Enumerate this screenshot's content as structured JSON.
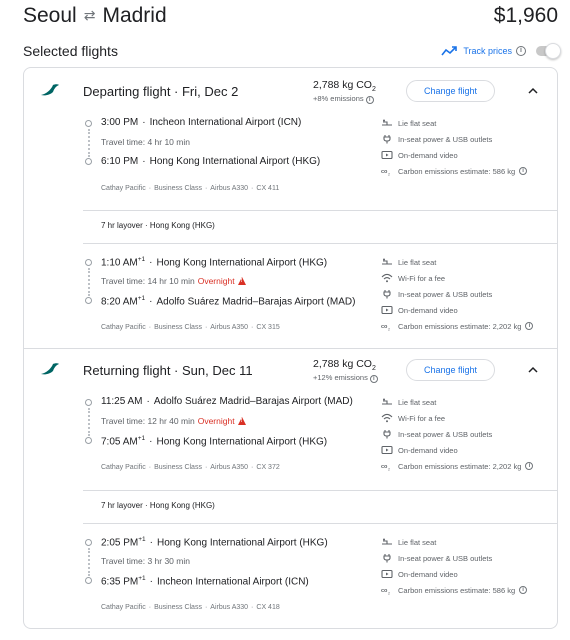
{
  "header": {
    "origin": "Seoul",
    "destination": "Madrid",
    "price": "$1,960"
  },
  "selected": {
    "title": "Selected flights",
    "track_label": "Track prices",
    "track_enabled": false
  },
  "colors": {
    "accent": "#1a73e8",
    "warning": "#d93025",
    "airline": "#006564"
  },
  "departing": {
    "title": "Departing flight · Fri, Dec 2",
    "co2": "2,788 kg CO",
    "co2_sub": "2",
    "emissions": "+8% emissions",
    "change_label": "Change flight",
    "legs": [
      {
        "dep_time": "3:00 PM",
        "dep_sup": "",
        "dep_airport": "Incheon International Airport (ICN)",
        "travel": "Travel time: 4 hr 10 min",
        "overnight": "",
        "arr_time": "6:10 PM",
        "arr_sup": "",
        "arr_airport": "Hong Kong International Airport (HKG)",
        "meta": [
          "Cathay Pacific",
          "Business Class",
          "Airbus A330",
          "CX 411"
        ],
        "amenities": [
          {
            "icon": "lie-flat-seat-icon",
            "label": "Lie flat seat"
          },
          {
            "icon": "power-outlet-icon",
            "label": "In-seat power & USB outlets"
          },
          {
            "icon": "video-icon",
            "label": "On-demand video"
          },
          {
            "icon": "co2-icon",
            "label": "Carbon emissions estimate: 586 kg"
          }
        ]
      },
      {
        "dep_time": "1:10 AM",
        "dep_sup": "+1",
        "dep_airport": "Hong Kong International Airport (HKG)",
        "travel": "Travel time: 14 hr 10 min",
        "overnight": "Overnight",
        "arr_time": "8:20 AM",
        "arr_sup": "+1",
        "arr_airport": "Adolfo Suárez Madrid–Barajas Airport (MAD)",
        "meta": [
          "Cathay Pacific",
          "Business Class",
          "Airbus A350",
          "CX 315"
        ],
        "amenities": [
          {
            "icon": "lie-flat-seat-icon",
            "label": "Lie flat seat"
          },
          {
            "icon": "wifi-icon",
            "label": "Wi-Fi for a fee"
          },
          {
            "icon": "power-outlet-icon",
            "label": "In-seat power & USB outlets"
          },
          {
            "icon": "video-icon",
            "label": "On-demand video"
          },
          {
            "icon": "co2-icon",
            "label": "Carbon emissions estimate: 2,202 kg"
          }
        ]
      }
    ],
    "layover": "7 hr layover · Hong Kong (HKG)"
  },
  "returning": {
    "title": "Returning flight · Sun, Dec 11",
    "co2": "2,788 kg CO",
    "co2_sub": "2",
    "emissions": "+12% emissions",
    "change_label": "Change flight",
    "legs": [
      {
        "dep_time": "11:25 AM",
        "dep_sup": "",
        "dep_airport": "Adolfo Suárez Madrid–Barajas Airport (MAD)",
        "travel": "Travel time: 12 hr 40 min",
        "overnight": "Overnight",
        "arr_time": "7:05 AM",
        "arr_sup": "+1",
        "arr_airport": "Hong Kong International Airport (HKG)",
        "meta": [
          "Cathay Pacific",
          "Business Class",
          "Airbus A350",
          "CX 372"
        ],
        "amenities": [
          {
            "icon": "lie-flat-seat-icon",
            "label": "Lie flat seat"
          },
          {
            "icon": "wifi-icon",
            "label": "Wi-Fi for a fee"
          },
          {
            "icon": "power-outlet-icon",
            "label": "In-seat power & USB outlets"
          },
          {
            "icon": "video-icon",
            "label": "On-demand video"
          },
          {
            "icon": "co2-icon",
            "label": "Carbon emissions estimate: 2,202 kg"
          }
        ]
      },
      {
        "dep_time": "2:05 PM",
        "dep_sup": "+1",
        "dep_airport": "Hong Kong International Airport (HKG)",
        "travel": "Travel time: 3 hr 30 min",
        "overnight": "",
        "arr_time": "6:35 PM",
        "arr_sup": "+1",
        "arr_airport": "Incheon International Airport (ICN)",
        "meta": [
          "Cathay Pacific",
          "Business Class",
          "Airbus A330",
          "CX 418"
        ],
        "amenities": [
          {
            "icon": "lie-flat-seat-icon",
            "label": "Lie flat seat"
          },
          {
            "icon": "power-outlet-icon",
            "label": "In-seat power & USB outlets"
          },
          {
            "icon": "video-icon",
            "label": "On-demand video"
          },
          {
            "icon": "co2-icon",
            "label": "Carbon emissions estimate: 586 kg"
          }
        ]
      }
    ],
    "layover": "7 hr layover · Hong Kong (HKG)"
  }
}
